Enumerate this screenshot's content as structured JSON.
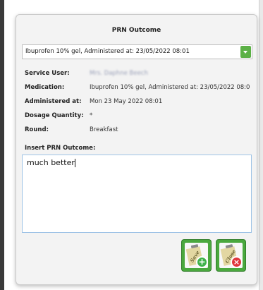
{
  "dialog": {
    "title": "PRN Outcome",
    "dropdown_value": "Ibuprofen 10% gel, Administered at: 23/05/2022 08:01",
    "fields": [
      {
        "label": "Service User:",
        "value": "Mrs. Daphne Beech"
      },
      {
        "label": "Medication:",
        "value": "Ibuprofen 10% gel, Administered at: 23/05/2022 08:0"
      },
      {
        "label": "Administered at:",
        "value": "Mon 23 May 2022 08:01"
      },
      {
        "label": "Dosage Quantity:",
        "value": "*"
      },
      {
        "label": "Round:",
        "value": "Breakfast"
      }
    ],
    "outcome_label": "Insert PRN Outcome:",
    "outcome_text": "much better",
    "save_label": "Save",
    "close_label": "Close"
  },
  "colors": {
    "accent_green": "#4aa83e",
    "close_red": "#e0363c"
  }
}
